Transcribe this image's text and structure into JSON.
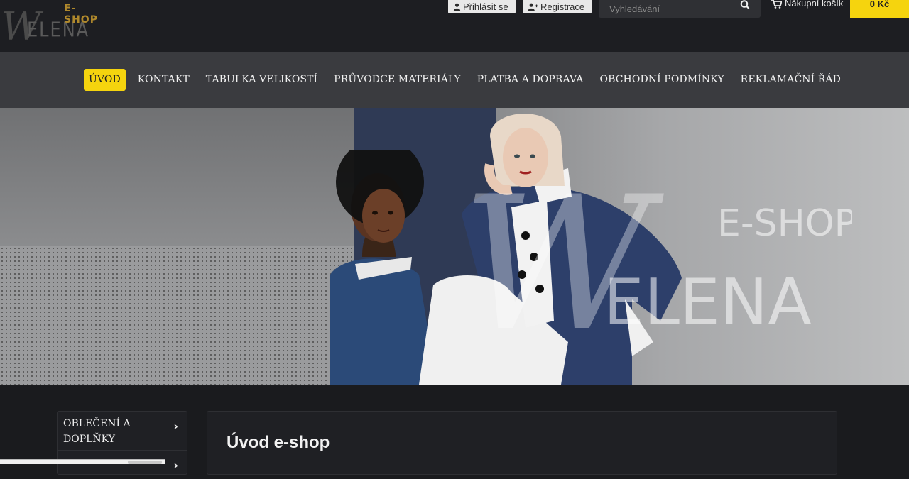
{
  "logo": {
    "w": "W",
    "elena": "ELENA",
    "eshop": "E-SHOP"
  },
  "header": {
    "login_label": "Přihlásit se",
    "register_label": "Registrace",
    "search_placeholder": "Vyhledávání",
    "cart_label": "Nákupní košík",
    "cart_total": "0 Kč"
  },
  "nav": {
    "items": [
      {
        "label": "ÚVOD",
        "active": true
      },
      {
        "label": "KONTAKT"
      },
      {
        "label": "TABULKA VELIKOSTÍ"
      },
      {
        "label": "PRŮVODCE MATERIÁLY"
      },
      {
        "label": "PLATBA A DOPRAVA"
      },
      {
        "label": "OBCHODNÍ PODMÍNKY"
      },
      {
        "label": "REKLAMAČNÍ ŘÁD"
      }
    ]
  },
  "hero": {
    "watermark_eshop": "E-SHOP",
    "watermark_elena": "ELENA",
    "watermark_w": "W"
  },
  "sidebar": {
    "items": [
      {
        "label": "OBLEČENÍ A DOPLŇKY"
      },
      {
        "label": ""
      }
    ]
  },
  "main": {
    "title": "Úvod e-shop"
  },
  "colors": {
    "accent": "#f5d40e",
    "nav_bg": "#3a3b3f",
    "top_bg": "#1d1e22"
  }
}
